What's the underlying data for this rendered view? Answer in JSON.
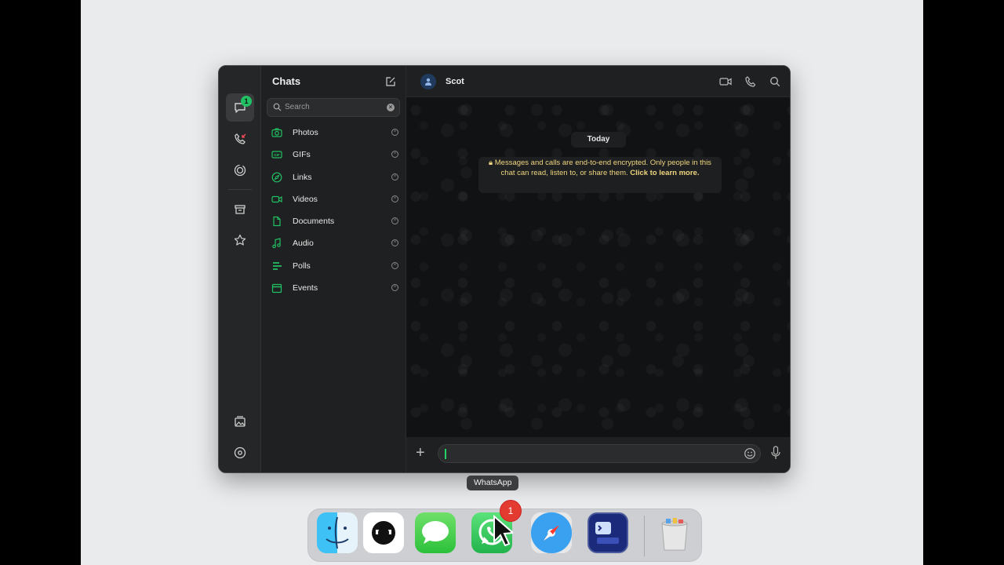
{
  "window": {
    "sidebar_title": "Chats",
    "search_placeholder": "Search",
    "chats_badge": "1",
    "filters": [
      {
        "label": "Photos",
        "icon": "camera-icon"
      },
      {
        "label": "GIFs",
        "icon": "gif-icon"
      },
      {
        "label": "Links",
        "icon": "compass-icon"
      },
      {
        "label": "Videos",
        "icon": "video-icon"
      },
      {
        "label": "Documents",
        "icon": "document-icon"
      },
      {
        "label": "Audio",
        "icon": "music-note-icon"
      },
      {
        "label": "Polls",
        "icon": "poll-icon"
      },
      {
        "label": "Events",
        "icon": "calendar-icon"
      }
    ]
  },
  "chat": {
    "contact_name": "Scot",
    "date_divider": "Today",
    "encryption_notice": "Messages and calls are end-to-end encrypted. Only people in this chat can read, listen to, or share them.",
    "encryption_link": "Click to learn more."
  },
  "dock": {
    "tooltip": "WhatsApp",
    "whatsapp_badge": "1",
    "apps": [
      "Finder",
      "ChatGPT",
      "Messages",
      "WhatsApp",
      "Safari",
      "Xcode-like Terminal",
      "Trash"
    ]
  },
  "colors": {
    "accent_green": "#21c063",
    "notice_text": "#f1d580",
    "badge_red": "#e33b30"
  }
}
